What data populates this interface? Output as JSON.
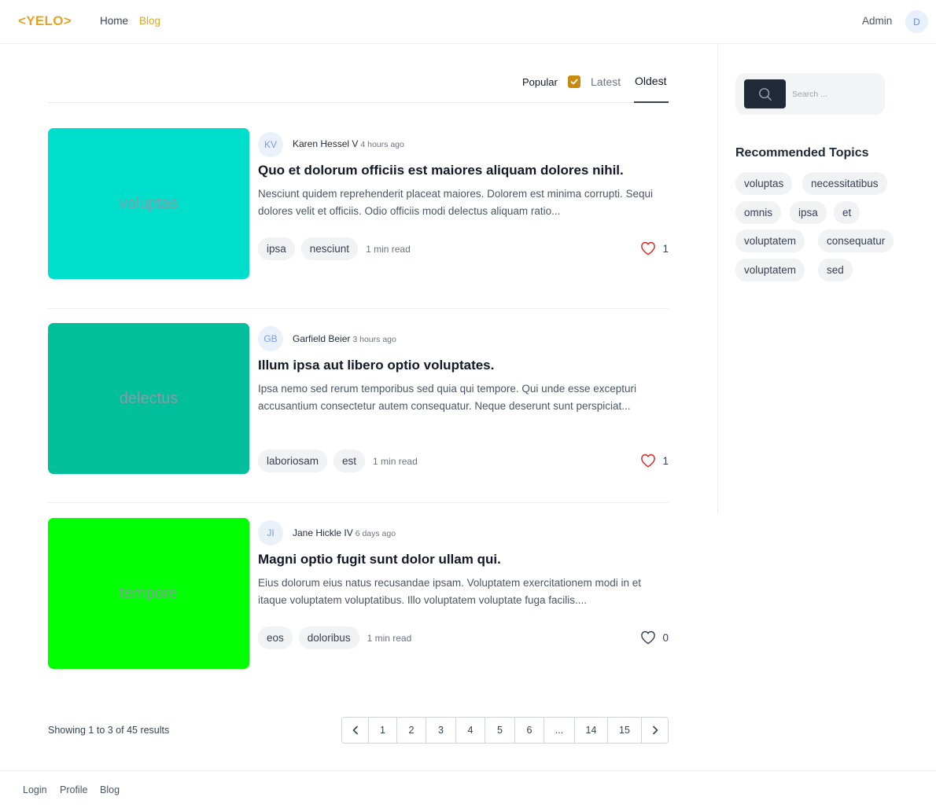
{
  "header": {
    "logo": "<YELO>",
    "nav": [
      {
        "label": "Home"
      },
      {
        "label": "Blog"
      }
    ],
    "user_name": "Admin",
    "avatar_initial": "D"
  },
  "sort": {
    "popular": "Popular",
    "latest": "Latest",
    "oldest": "Oldest"
  },
  "articles": [
    {
      "thumb_text": "voluptas",
      "thumb_color": "#00dfcb",
      "author_initials": "KV",
      "author": "Karen Hessel V",
      "time": "4 hours ago",
      "title": "Quo et dolorum officiis est maiores aliquam dolores nihil.",
      "excerpt": "Nesciunt quidem reprehenderit placeat maiores. Dolorem est minima corrupti. Sequi dolores velit et officiis. Odio officiis modi delectus aliquam ratio...",
      "tags": [
        "ipsa",
        "nesciunt"
      ],
      "read_time": "1 min read",
      "likes": "1",
      "liked": true
    },
    {
      "thumb_text": "delectus",
      "thumb_color": "#00bf9a",
      "author_initials": "GB",
      "author": "Garfield Beier",
      "time": "3 hours ago",
      "title": "Illum ipsa aut libero optio voluptates.",
      "excerpt": "Ipsa nemo sed rerum temporibus sed quia qui tempore. Qui unde esse excepturi accusantium consectetur autem consequatur. Neque deserunt sunt perspiciat...",
      "tags": [
        "laboriosam",
        "est"
      ],
      "read_time": "1 min read",
      "likes": "1",
      "liked": true
    },
    {
      "thumb_text": "tempore",
      "thumb_color": "#00ff00",
      "author_initials": "JI",
      "author": "Jane Hickle IV",
      "time": "6 days ago",
      "title": "Magni optio fugit sunt dolor ullam qui.",
      "excerpt": "Eius dolorum eius natus recusandae ipsam. Voluptatem exercitationem modi in et itaque voluptatem voluptatibus. Illo voluptatem voluptate fuga facilis....",
      "tags": [
        "eos",
        "doloribus"
      ],
      "read_time": "1 min read",
      "likes": "0",
      "liked": false
    }
  ],
  "pagination": {
    "summary": "Showing 1 to 3 of 45 results",
    "pages": [
      "1",
      "2",
      "3",
      "4",
      "5",
      "6",
      "...",
      "14",
      "15"
    ]
  },
  "sidebar": {
    "search_placeholder": "Search ...",
    "rec_title": "Recommended Topics",
    "topics": [
      "voluptas",
      "necessitatibus",
      "omnis",
      "ipsa",
      "et",
      "voluptatem",
      "consequatur",
      "voluptatem",
      "sed"
    ]
  },
  "footer": {
    "links": [
      "Login",
      "Profile",
      "Blog"
    ]
  },
  "colors": {
    "accent": "#e0a526",
    "liked_heart": "#dc2626",
    "search_button": "#1f2937"
  }
}
